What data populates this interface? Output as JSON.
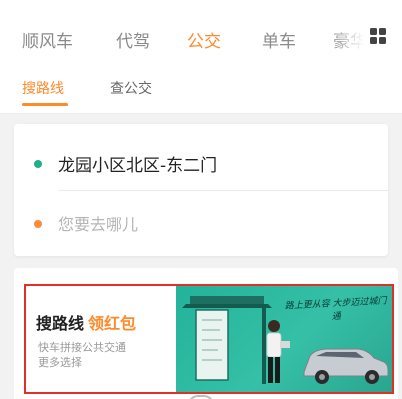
{
  "top_tabs": [
    {
      "label": "顺风车",
      "active": false
    },
    {
      "label": "代驾",
      "active": false
    },
    {
      "label": "公交",
      "active": true
    },
    {
      "label": "单车",
      "active": false
    },
    {
      "label": "豪华",
      "active": false
    }
  ],
  "more_icon": "grid-icon",
  "sub_tabs": [
    {
      "label": "搜路线",
      "active": true
    },
    {
      "label": "查公交",
      "active": false
    }
  ],
  "address": {
    "from": "龙园小区北区-东二门",
    "to_placeholder": "您要去哪儿"
  },
  "banner": {
    "title": "搜路线",
    "highlight": "领红包",
    "desc_line1": "快车拼接公共交通",
    "desc_line2": "更多选择",
    "scene_text": "路上更从容 大步迈过城门通"
  },
  "colors": {
    "accent": "#ff8a2a",
    "start_dot": "#1fb08a",
    "end_dot": "#ff8a3d",
    "banner_border": "#e0302a",
    "banner_scene": "#2bb59c"
  }
}
